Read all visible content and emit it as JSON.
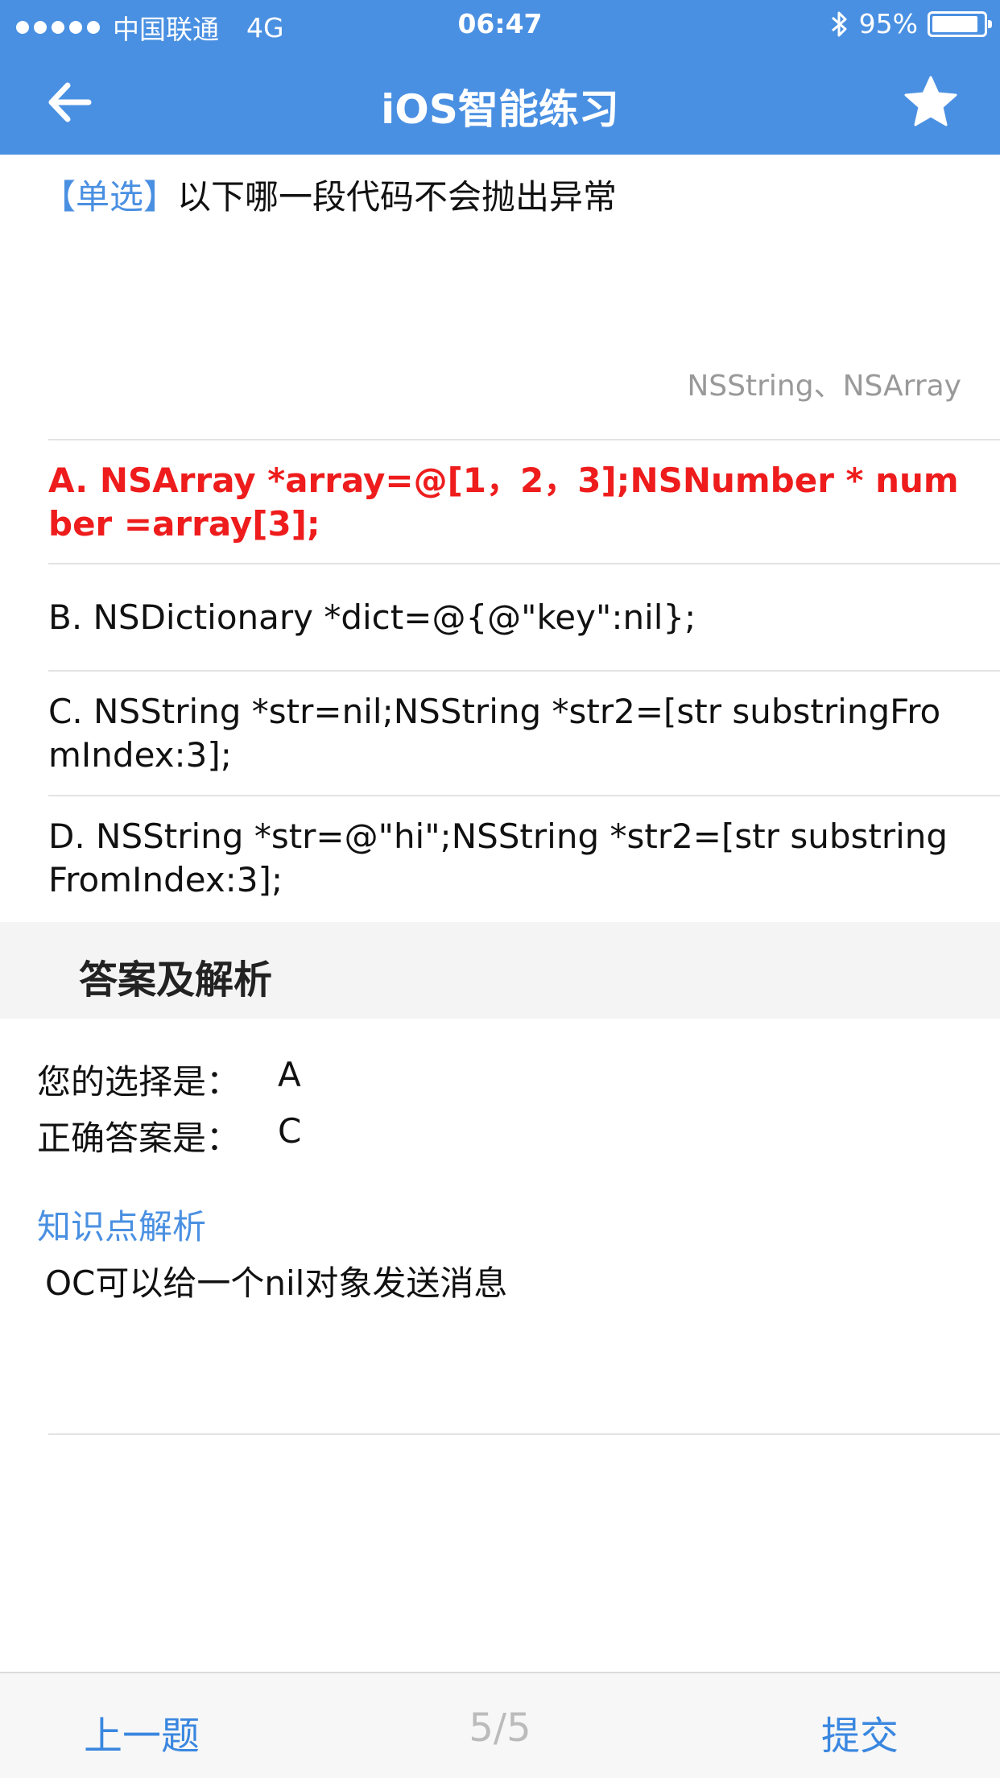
{
  "status_bar": {
    "carrier": "中国联通",
    "network": "4G",
    "time": "06:47",
    "battery_percent": "95%",
    "battery_level": 0.95,
    "icons": [
      "signal-dots-icon",
      "bluetooth-icon",
      "battery-icon"
    ]
  },
  "nav": {
    "title": "iOS智能练习",
    "back_icon": "arrow-left-icon",
    "favorite_icon": "star-icon"
  },
  "question": {
    "type_label": "【单选】",
    "text": "以下哪一段代码不会抛出异常",
    "tags": "NSString、NSArray"
  },
  "options": [
    {
      "label": "A. NSArray *array=@[1，2，3];NSNumber * number =array[3];",
      "state": "selected-wrong"
    },
    {
      "label": "B. NSDictionary *dict=@{@\"key\":nil};",
      "state": "normal"
    },
    {
      "label": "C. NSString *str=nil;NSString *str2=[str substringFromIndex:3];",
      "state": "normal"
    },
    {
      "label": "D. NSString *str=@\"hi\";NSString *str2=[str substringFromIndex:3];",
      "state": "normal"
    }
  ],
  "analysis": {
    "header": "答案及解析",
    "your_choice_label": "您的选择是：",
    "your_choice_value": "A",
    "correct_label": "正确答案是：",
    "correct_value": "C",
    "knowledge_title": "知识点解析",
    "knowledge_text": "OC可以给一个nil对象发送消息"
  },
  "bottom": {
    "prev_label": "上一题",
    "page_indicator": "5/5",
    "submit_label": "提交"
  },
  "colors": {
    "nav_blue": "#4a90e2",
    "wrong_red": "#ee1c1c",
    "link_blue": "#3a87e0"
  }
}
